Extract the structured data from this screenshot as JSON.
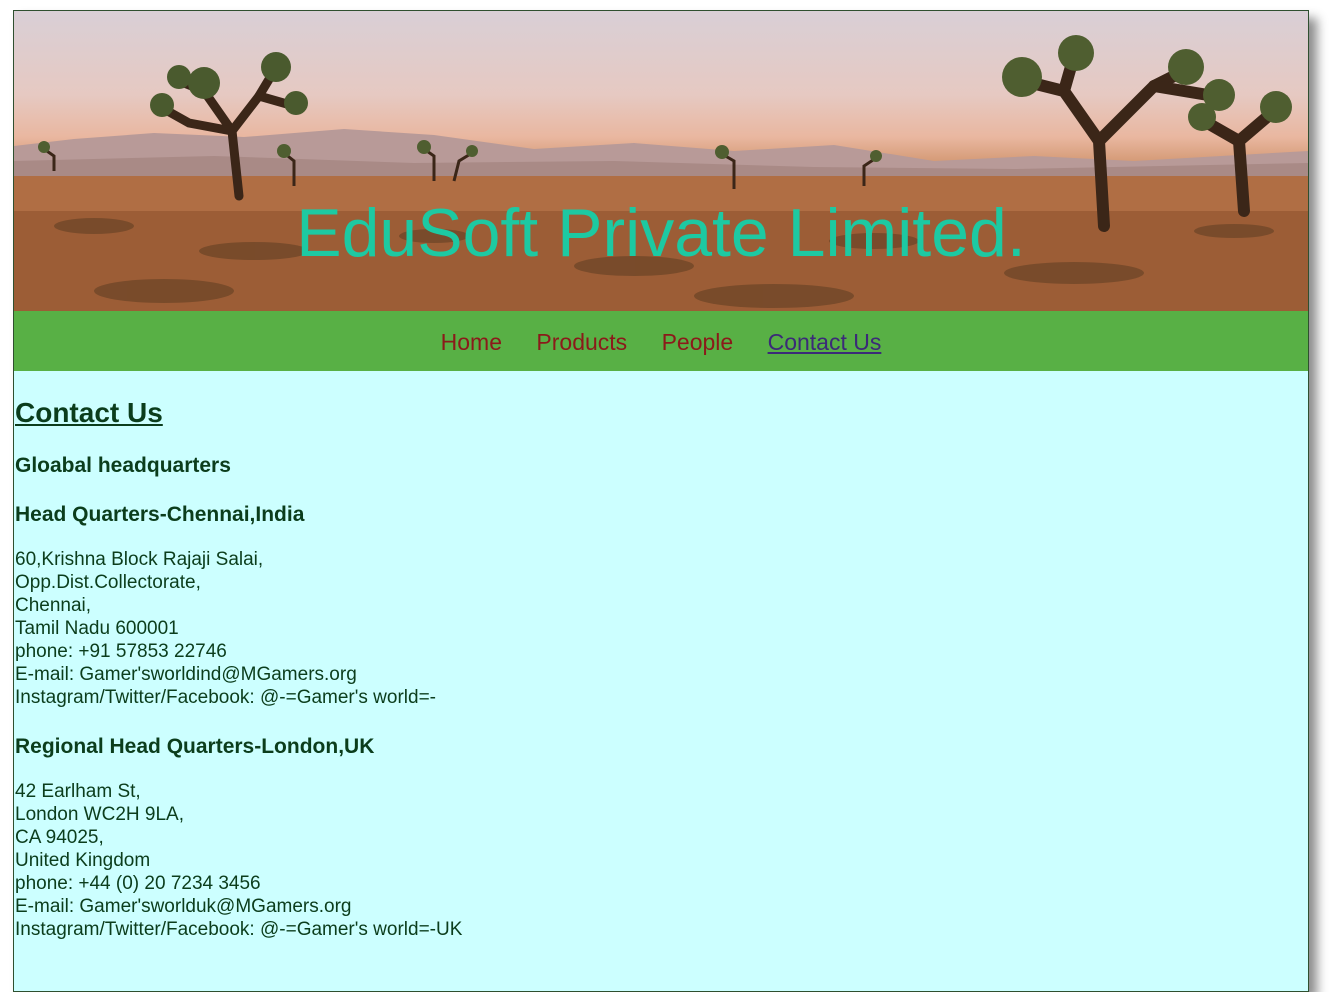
{
  "banner": {
    "title": "EduSoft Private Limited.",
    "image": "desert-joshua-trees-image"
  },
  "nav": {
    "items": [
      {
        "label": "Home"
      },
      {
        "label": "Products"
      },
      {
        "label": "People"
      },
      {
        "label": "Contact Us",
        "current": true
      }
    ]
  },
  "content": {
    "page_title": "Contact Us",
    "section_heading": "Gloabal headquarters",
    "offices": [
      {
        "heading": "Head Quarters-Chennai,India",
        "lines": [
          "60,Krishna Block Rajaji Salai,",
          "Opp.Dist.Collectorate,",
          "Chennai,",
          "Tamil Nadu 600001",
          "phone: +91 57853 22746",
          "E-mail: Gamer'sworldind@MGamers.org",
          "Instagram/Twitter/Facebook: @-=Gamer's world=-"
        ]
      },
      {
        "heading": "Regional Head Quarters-London,UK",
        "lines": [
          "42 Earlham St,",
          "London WC2H 9LA,",
          "CA 94025,",
          "United Kingdom",
          "phone: +44 (0) 20 7234 3456",
          "E-mail: Gamer'sworlduk@MGamers.org",
          "Instagram/Twitter/Facebook: @-=Gamer's world=-UK"
        ]
      }
    ]
  },
  "colors": {
    "title": "#1dc9a2",
    "nav_bg": "#58b045",
    "nav_link": "#8b1a1a",
    "nav_current": "#3b2a78",
    "content_bg": "#ccffff",
    "text": "#0b3d1c"
  }
}
